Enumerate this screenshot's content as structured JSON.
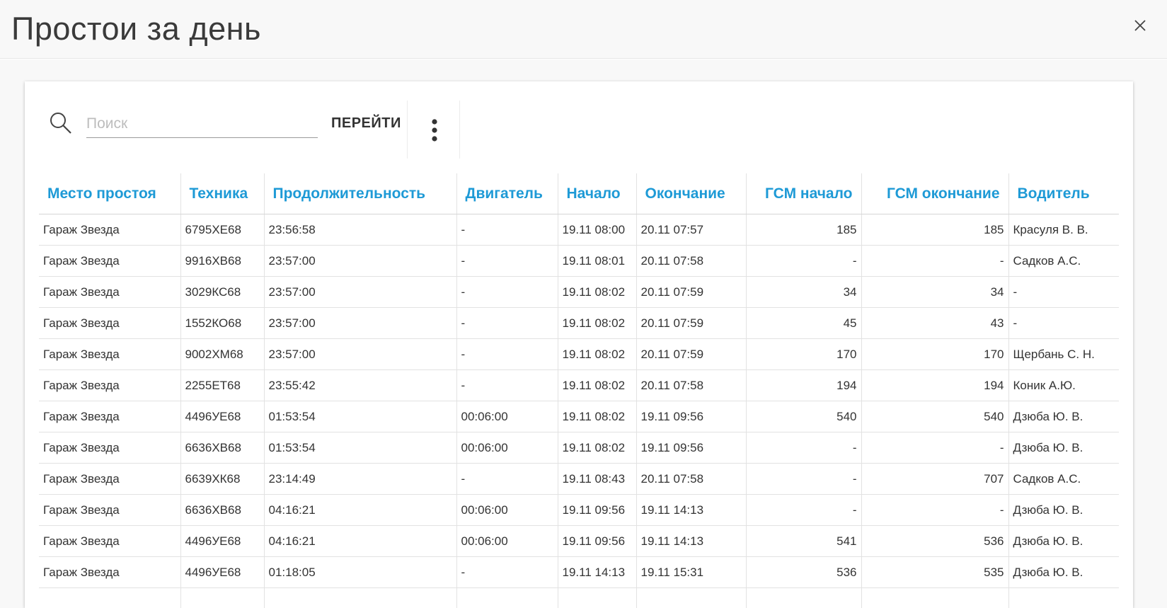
{
  "header": {
    "title": "Простои за день"
  },
  "search": {
    "placeholder": "Поиск",
    "value": ""
  },
  "toolbar": {
    "go_label": "ПЕРЕЙТИ"
  },
  "table": {
    "columns": [
      "Место простоя",
      "Техника",
      "Продолжительность",
      "Двигатель",
      "Начало",
      "Окончание",
      "ГСМ начало",
      "ГСМ окончание",
      "Водитель"
    ],
    "rows": [
      [
        "Гараж Звезда",
        "6795ХЕ68",
        "23:56:58",
        "-",
        "19.11 08:00",
        "20.11 07:57",
        "185",
        "185",
        "Красуля В. В."
      ],
      [
        "Гараж Звезда",
        "9916ХВ68",
        "23:57:00",
        "-",
        "19.11 08:01",
        "20.11 07:58",
        "-",
        "-",
        "Садков А.С."
      ],
      [
        "Гараж Звезда",
        "3029КС68",
        "23:57:00",
        "-",
        "19.11 08:02",
        "20.11 07:59",
        "34",
        "34",
        "-"
      ],
      [
        "Гараж Звезда",
        "1552КО68",
        "23:57:00",
        "-",
        "19.11 08:02",
        "20.11 07:59",
        "45",
        "43",
        "-"
      ],
      [
        "Гараж Звезда",
        "9002ХМ68",
        "23:57:00",
        "-",
        "19.11 08:02",
        "20.11 07:59",
        "170",
        "170",
        "Щербань С. Н."
      ],
      [
        "Гараж Звезда",
        "2255ЕТ68",
        "23:55:42",
        "-",
        "19.11 08:02",
        "20.11 07:58",
        "194",
        "194",
        "Коник А.Ю."
      ],
      [
        "Гараж Звезда",
        "4496УЕ68",
        "01:53:54",
        "00:06:00",
        "19.11 08:02",
        "19.11 09:56",
        "540",
        "540",
        "Дзюба Ю. В."
      ],
      [
        "Гараж Звезда",
        "6636ХВ68",
        "01:53:54",
        "00:06:00",
        "19.11 08:02",
        "19.11 09:56",
        "-",
        "-",
        "Дзюба Ю. В."
      ],
      [
        "Гараж Звезда",
        "6639ХК68",
        "23:14:49",
        "-",
        "19.11 08:43",
        "20.11 07:58",
        "-",
        "707",
        "Садков А.С."
      ],
      [
        "Гараж Звезда",
        "6636ХВ68",
        "04:16:21",
        "00:06:00",
        "19.11 09:56",
        "19.11 14:13",
        "-",
        "-",
        "Дзюба Ю. В."
      ],
      [
        "Гараж Звезда",
        "4496УЕ68",
        "04:16:21",
        "00:06:00",
        "19.11 09:56",
        "19.11 14:13",
        "541",
        "536",
        "Дзюба Ю. В."
      ],
      [
        "Гараж Звезда",
        "4496УЕ68",
        "01:18:05",
        "-",
        "19.11 14:13",
        "19.11 15:31",
        "536",
        "535",
        "Дзюба Ю. В."
      ],
      [
        "",
        "",
        "",
        "",
        "",
        "",
        "",
        "",
        ""
      ]
    ]
  },
  "colors": {
    "accent": "#1e9ad6",
    "header_bg": "#f8f8f8",
    "text": "#333333"
  },
  "icons": {
    "close": "close-icon",
    "search": "search-icon",
    "more": "more-vertical-icon"
  }
}
